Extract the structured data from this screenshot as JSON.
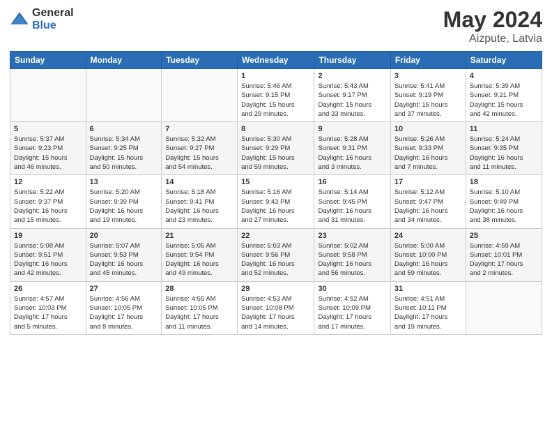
{
  "logo": {
    "general": "General",
    "blue": "Blue"
  },
  "title": {
    "month": "May 2024",
    "location": "Aizpute, Latvia"
  },
  "headers": [
    "Sunday",
    "Monday",
    "Tuesday",
    "Wednesday",
    "Thursday",
    "Friday",
    "Saturday"
  ],
  "weeks": [
    [
      {
        "day": "",
        "info": ""
      },
      {
        "day": "",
        "info": ""
      },
      {
        "day": "",
        "info": ""
      },
      {
        "day": "1",
        "info": "Sunrise: 5:46 AM\nSunset: 9:15 PM\nDaylight: 15 hours\nand 29 minutes."
      },
      {
        "day": "2",
        "info": "Sunrise: 5:43 AM\nSunset: 9:17 PM\nDaylight: 15 hours\nand 33 minutes."
      },
      {
        "day": "3",
        "info": "Sunrise: 5:41 AM\nSunset: 9:19 PM\nDaylight: 15 hours\nand 37 minutes."
      },
      {
        "day": "4",
        "info": "Sunrise: 5:39 AM\nSunset: 9:21 PM\nDaylight: 15 hours\nand 42 minutes."
      }
    ],
    [
      {
        "day": "5",
        "info": "Sunrise: 5:37 AM\nSunset: 9:23 PM\nDaylight: 15 hours\nand 46 minutes."
      },
      {
        "day": "6",
        "info": "Sunrise: 5:34 AM\nSunset: 9:25 PM\nDaylight: 15 hours\nand 50 minutes."
      },
      {
        "day": "7",
        "info": "Sunrise: 5:32 AM\nSunset: 9:27 PM\nDaylight: 15 hours\nand 54 minutes."
      },
      {
        "day": "8",
        "info": "Sunrise: 5:30 AM\nSunset: 9:29 PM\nDaylight: 15 hours\nand 59 minutes."
      },
      {
        "day": "9",
        "info": "Sunrise: 5:28 AM\nSunset: 9:31 PM\nDaylight: 16 hours\nand 3 minutes."
      },
      {
        "day": "10",
        "info": "Sunrise: 5:26 AM\nSunset: 9:33 PM\nDaylight: 16 hours\nand 7 minutes."
      },
      {
        "day": "11",
        "info": "Sunrise: 5:24 AM\nSunset: 9:35 PM\nDaylight: 16 hours\nand 11 minutes."
      }
    ],
    [
      {
        "day": "12",
        "info": "Sunrise: 5:22 AM\nSunset: 9:37 PM\nDaylight: 16 hours\nand 15 minutes."
      },
      {
        "day": "13",
        "info": "Sunrise: 5:20 AM\nSunset: 9:39 PM\nDaylight: 16 hours\nand 19 minutes."
      },
      {
        "day": "14",
        "info": "Sunrise: 5:18 AM\nSunset: 9:41 PM\nDaylight: 16 hours\nand 23 minutes."
      },
      {
        "day": "15",
        "info": "Sunrise: 5:16 AM\nSunset: 9:43 PM\nDaylight: 16 hours\nand 27 minutes."
      },
      {
        "day": "16",
        "info": "Sunrise: 5:14 AM\nSunset: 9:45 PM\nDaylight: 16 hours\nand 31 minutes."
      },
      {
        "day": "17",
        "info": "Sunrise: 5:12 AM\nSunset: 9:47 PM\nDaylight: 16 hours\nand 34 minutes."
      },
      {
        "day": "18",
        "info": "Sunrise: 5:10 AM\nSunset: 9:49 PM\nDaylight: 16 hours\nand 38 minutes."
      }
    ],
    [
      {
        "day": "19",
        "info": "Sunrise: 5:08 AM\nSunset: 9:51 PM\nDaylight: 16 hours\nand 42 minutes."
      },
      {
        "day": "20",
        "info": "Sunrise: 5:07 AM\nSunset: 9:53 PM\nDaylight: 16 hours\nand 45 minutes."
      },
      {
        "day": "21",
        "info": "Sunrise: 5:05 AM\nSunset: 9:54 PM\nDaylight: 16 hours\nand 49 minutes."
      },
      {
        "day": "22",
        "info": "Sunrise: 5:03 AM\nSunset: 9:56 PM\nDaylight: 16 hours\nand 52 minutes."
      },
      {
        "day": "23",
        "info": "Sunrise: 5:02 AM\nSunset: 9:58 PM\nDaylight: 16 hours\nand 56 minutes."
      },
      {
        "day": "24",
        "info": "Sunrise: 5:00 AM\nSunset: 10:00 PM\nDaylight: 16 hours\nand 59 minutes."
      },
      {
        "day": "25",
        "info": "Sunrise: 4:59 AM\nSunset: 10:01 PM\nDaylight: 17 hours\nand 2 minutes."
      }
    ],
    [
      {
        "day": "26",
        "info": "Sunrise: 4:57 AM\nSunset: 10:03 PM\nDaylight: 17 hours\nand 5 minutes."
      },
      {
        "day": "27",
        "info": "Sunrise: 4:56 AM\nSunset: 10:05 PM\nDaylight: 17 hours\nand 8 minutes."
      },
      {
        "day": "28",
        "info": "Sunrise: 4:55 AM\nSunset: 10:06 PM\nDaylight: 17 hours\nand 11 minutes."
      },
      {
        "day": "29",
        "info": "Sunrise: 4:53 AM\nSunset: 10:08 PM\nDaylight: 17 hours\nand 14 minutes."
      },
      {
        "day": "30",
        "info": "Sunrise: 4:52 AM\nSunset: 10:09 PM\nDaylight: 17 hours\nand 17 minutes."
      },
      {
        "day": "31",
        "info": "Sunrise: 4:51 AM\nSunset: 10:11 PM\nDaylight: 17 hours\nand 19 minutes."
      },
      {
        "day": "",
        "info": ""
      }
    ]
  ]
}
